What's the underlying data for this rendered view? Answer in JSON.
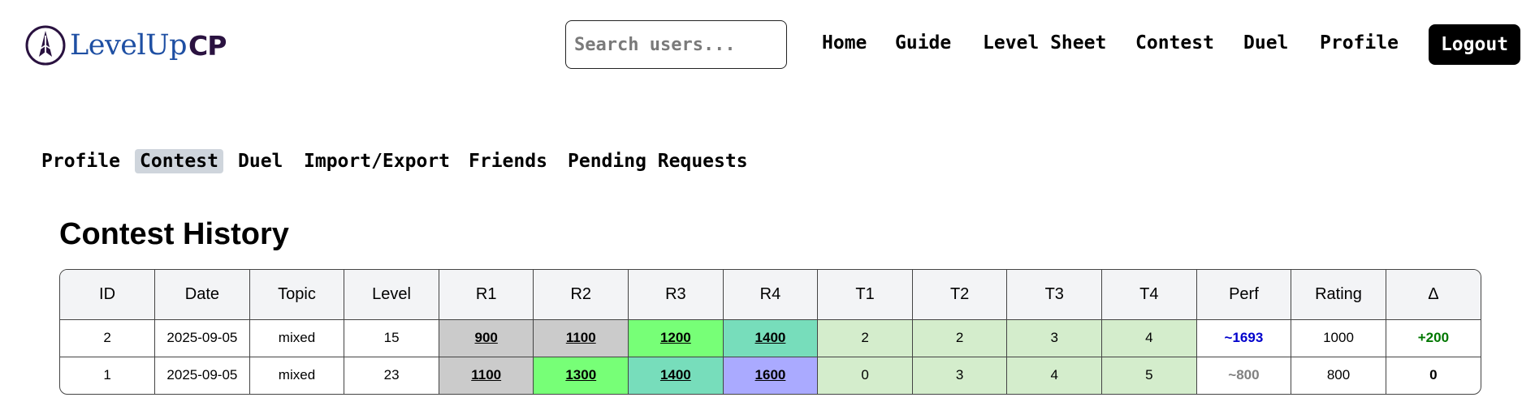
{
  "brand": {
    "name_main": "LevelUp",
    "name_suffix": "CP",
    "text_color": "#1e4fa3",
    "suffix_color": "#2a1240"
  },
  "search": {
    "placeholder": "Search users...",
    "value": ""
  },
  "nav": {
    "home": "Home",
    "guide": "Guide",
    "level_sheet": "Level Sheet",
    "contest": "Contest",
    "duel": "Duel",
    "profile": "Profile",
    "logout": "Logout"
  },
  "tabs": {
    "profile": "Profile",
    "contest": "Contest",
    "duel": "Duel",
    "import_export": "Import/Export",
    "friends": "Friends",
    "pending": "Pending Requests",
    "active": "contest"
  },
  "section_title": "Contest History",
  "table": {
    "headers": [
      "ID",
      "Date",
      "Topic",
      "Level",
      "R1",
      "R2",
      "R3",
      "R4",
      "T1",
      "T2",
      "T3",
      "T4",
      "Perf",
      "Rating",
      "Δ"
    ],
    "rows": [
      {
        "id": "2",
        "date": "2025-09-05",
        "topic": "mixed",
        "level": "15",
        "r": [
          {
            "v": "900",
            "color": "#cbcbcb"
          },
          {
            "v": "1100",
            "color": "#cbcbcb"
          },
          {
            "v": "1200",
            "color": "#77ff77"
          },
          {
            "v": "1400",
            "color": "#77ddbb"
          }
        ],
        "t": [
          "2",
          "2",
          "3",
          "4"
        ],
        "t_color": "#d4edcc",
        "perf": "~1693",
        "perf_color": "#0000cc",
        "rating": "1000",
        "delta": "+200",
        "delta_color": "#007700"
      },
      {
        "id": "1",
        "date": "2025-09-05",
        "topic": "mixed",
        "level": "23",
        "r": [
          {
            "v": "1100",
            "color": "#cbcbcb"
          },
          {
            "v": "1300",
            "color": "#77ff77"
          },
          {
            "v": "1400",
            "color": "#77ddbb"
          },
          {
            "v": "1600",
            "color": "#aaaaff"
          }
        ],
        "t": [
          "0",
          "3",
          "4",
          "5"
        ],
        "t_color": "#d4edcc",
        "perf": "~800",
        "perf_color": "#808080",
        "rating": "800",
        "delta": "0",
        "delta_color": "#000000"
      }
    ]
  }
}
